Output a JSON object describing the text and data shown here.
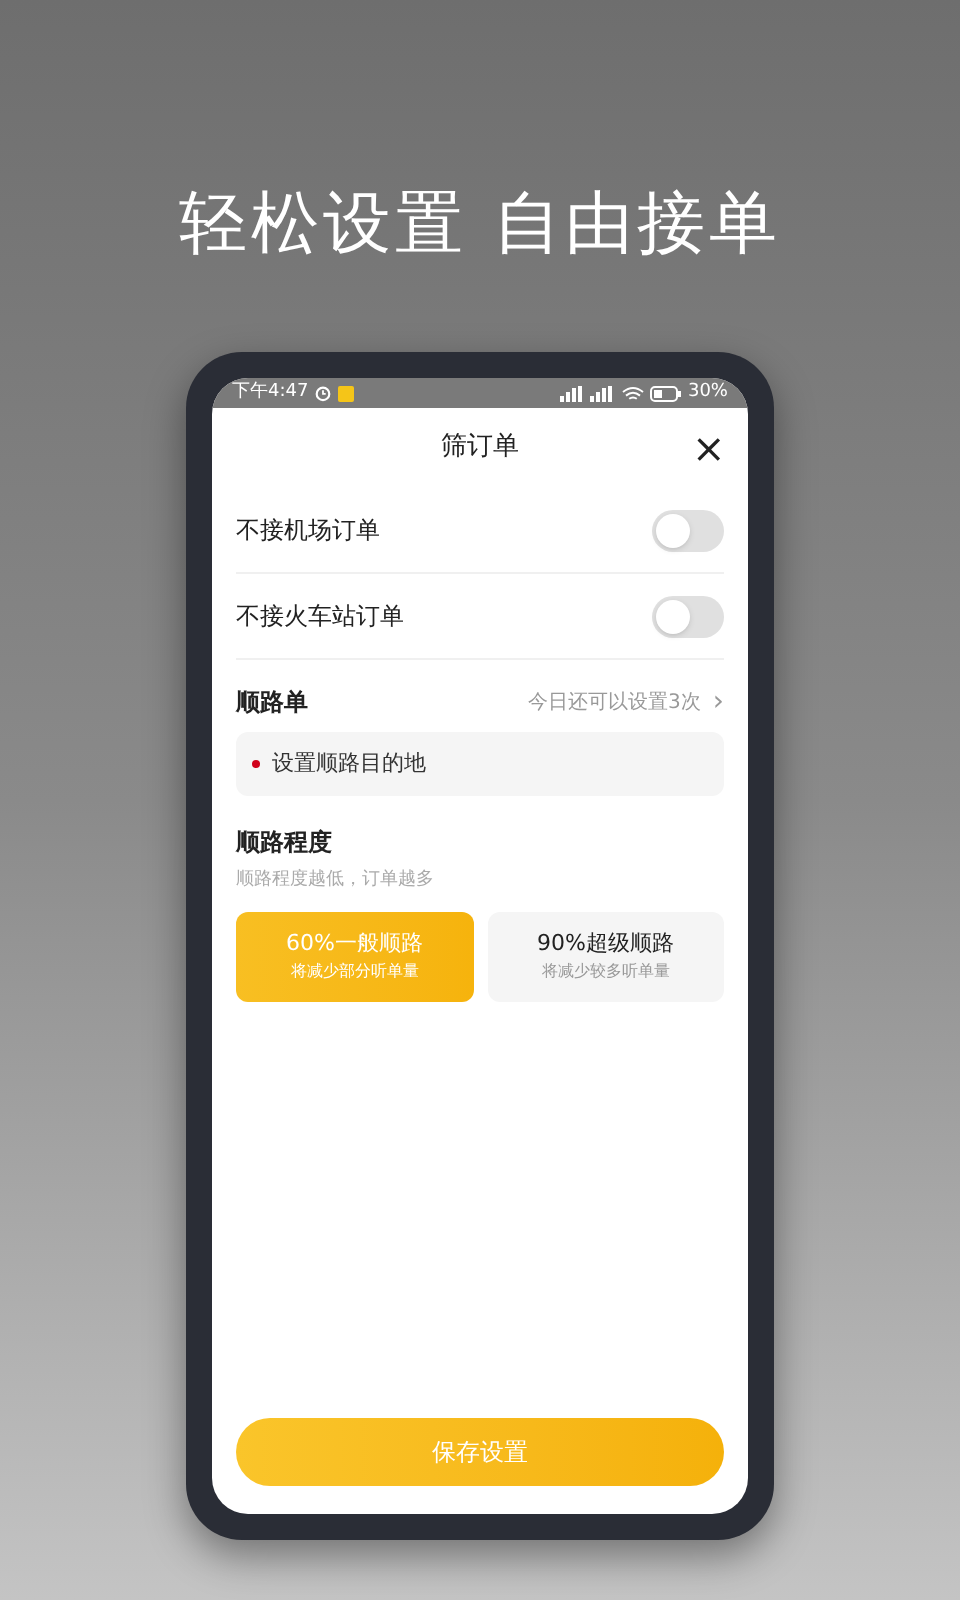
{
  "headline": "轻松设置 自由接单",
  "status_bar": {
    "time": "下午4:47",
    "battery": "30%"
  },
  "sheet": {
    "title": "筛订单",
    "close": "×"
  },
  "toggles": [
    {
      "label": "不接机场订单",
      "on": false
    },
    {
      "label": "不接火车站订单",
      "on": false
    }
  ],
  "route_order": {
    "title": "顺路单",
    "hint": "今日还可以设置3次",
    "chevron": "›",
    "destination": "设置顺路目的地"
  },
  "route_level": {
    "title": "顺路程度",
    "subtitle": "顺路程度越低，订单越多",
    "options": [
      {
        "label": "60%一般顺路",
        "note": "将减少部分听单量",
        "selected": true
      },
      {
        "label": "90%超级顺路",
        "note": "将减少较多听单量",
        "selected": false
      }
    ]
  },
  "save_button": "保存设置"
}
